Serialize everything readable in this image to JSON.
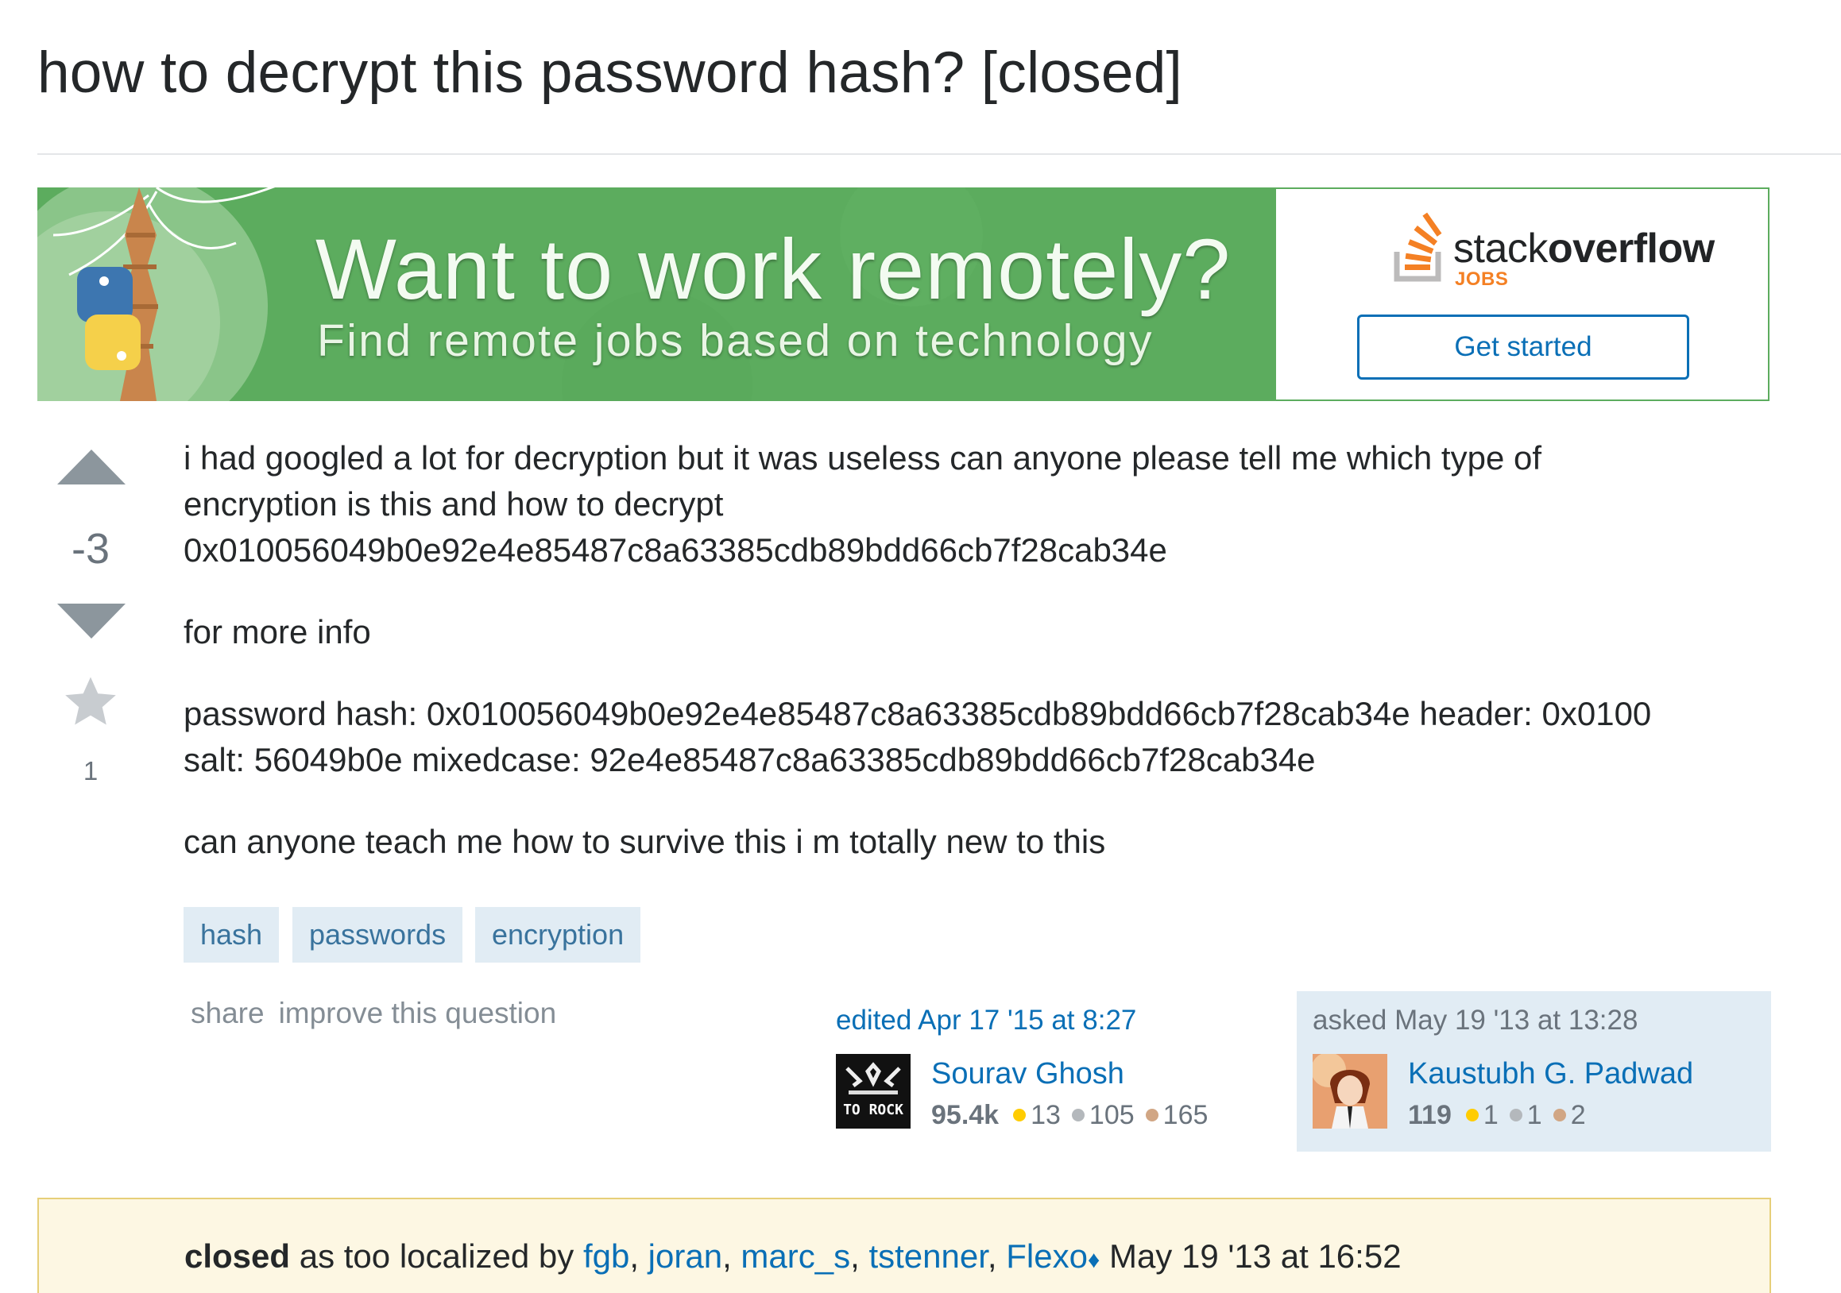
{
  "question": {
    "title": "how to decrypt this password hash? [closed]",
    "vote_count": "-3",
    "favorite_count": "1",
    "body": [
      "i had googled a lot for decryption but it was useless can anyone please tell me which type of",
      "encryption is this and how to decrypt",
      "0x010056049b0e92e4e85487c8a63385cdb89bdd66cb7f28cab34e",
      "for more info",
      "password hash: 0x010056049b0e92e4e85487c8a63385cdb89bdd66cb7f28cab34e header: 0x0100",
      "salt: 56049b0e mixedcase: 92e4e85487c8a63385cdb89bdd66cb7f28cab34e",
      "can anyone teach me how to survive this i m totally new to this"
    ],
    "tags": [
      "hash",
      "passwords",
      "encryption"
    ],
    "menu": {
      "share": "share",
      "improve": "improve this question"
    }
  },
  "ad": {
    "headline": "Want to work remotely?",
    "subline": "Find remote jobs based on technology",
    "logo_light": "stack",
    "logo_bold": "overflow",
    "logo_jobs": "JOBS",
    "cta": "Get started",
    "colors": {
      "banner_green": "#5cac5e",
      "brand_orange": "#f48024",
      "cta_blue": "#0a6fb6"
    }
  },
  "editor": {
    "time": "edited Apr 17 '15 at 8:27",
    "name": "Sourav Ghosh",
    "rep": "95.4k",
    "gold": "13",
    "silver": "105",
    "bronze": "165",
    "avatar_icon": "to-rock-avatar-icon"
  },
  "asker": {
    "time": "asked May 19 '13 at 13:28",
    "name": "Kaustubh G. Padwad",
    "rep": "119",
    "gold": "1",
    "silver": "1",
    "bronze": "2",
    "avatar_icon": "anime-avatar-icon"
  },
  "closed": {
    "status": "closed",
    "reason": " as too localized by ",
    "users": [
      "fgb",
      "joran",
      "marc_s",
      "tstenner",
      "Flexo"
    ],
    "time": "May 19 '13 at 16:52"
  }
}
